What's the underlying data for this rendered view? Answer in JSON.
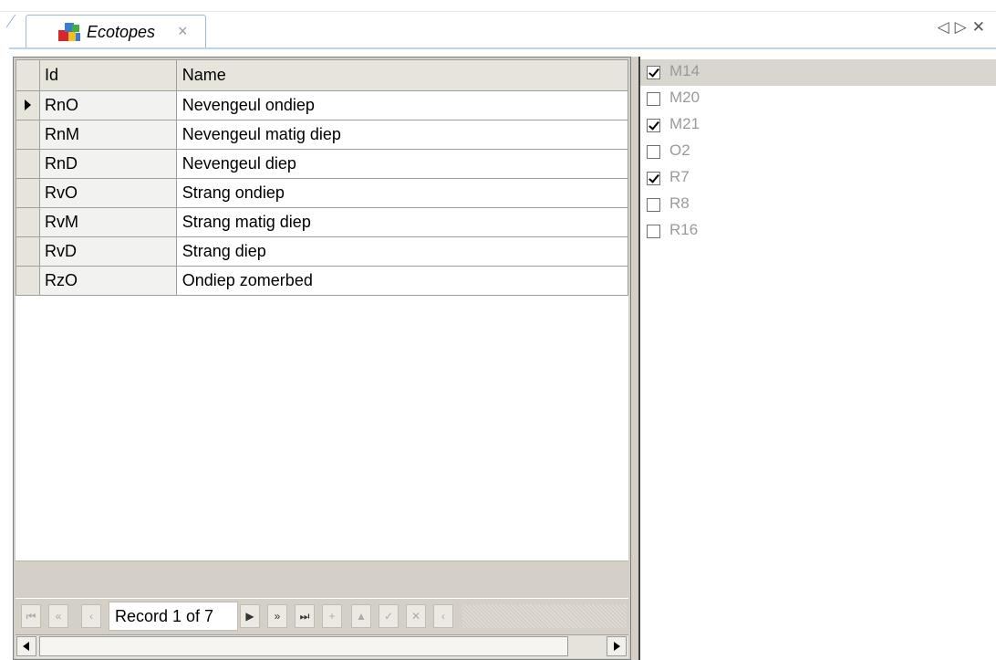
{
  "tab": {
    "label": "Ecotopes",
    "close_glyph": "×",
    "icon": "ecotopes-icon"
  },
  "window_nav": {
    "prev": "◁",
    "next": "▷",
    "close": "✕"
  },
  "grid": {
    "columns": [
      "Id",
      "Name"
    ],
    "rows": [
      {
        "id": "RnO",
        "name": "Nevengeul ondiep"
      },
      {
        "id": "RnM",
        "name": "Nevengeul matig diep"
      },
      {
        "id": "RnD",
        "name": "Nevengeul diep"
      },
      {
        "id": "RvO",
        "name": "Strang ondiep"
      },
      {
        "id": "RvM",
        "name": "Strang matig diep"
      },
      {
        "id": "RvD",
        "name": "Strang diep"
      },
      {
        "id": "RzO",
        "name": "Ondiep zomerbed"
      }
    ],
    "current_row": 0
  },
  "navigator": {
    "record_text": "Record 1 of 7",
    "first": "⏮",
    "prev_page": "«",
    "prev": "‹",
    "next": "▶",
    "next_page": "»",
    "last": "⏭",
    "append": "+",
    "edit": "▲",
    "post": "✓",
    "cancel": "✕",
    "refresh": "‹"
  },
  "checklist": [
    {
      "label": "M14",
      "checked": true,
      "selected": true
    },
    {
      "label": "M20",
      "checked": false,
      "selected": false
    },
    {
      "label": "M21",
      "checked": true,
      "selected": false
    },
    {
      "label": "O2",
      "checked": false,
      "selected": false
    },
    {
      "label": "R7",
      "checked": true,
      "selected": false
    },
    {
      "label": "R8",
      "checked": false,
      "selected": false
    },
    {
      "label": "R16",
      "checked": false,
      "selected": false
    }
  ]
}
